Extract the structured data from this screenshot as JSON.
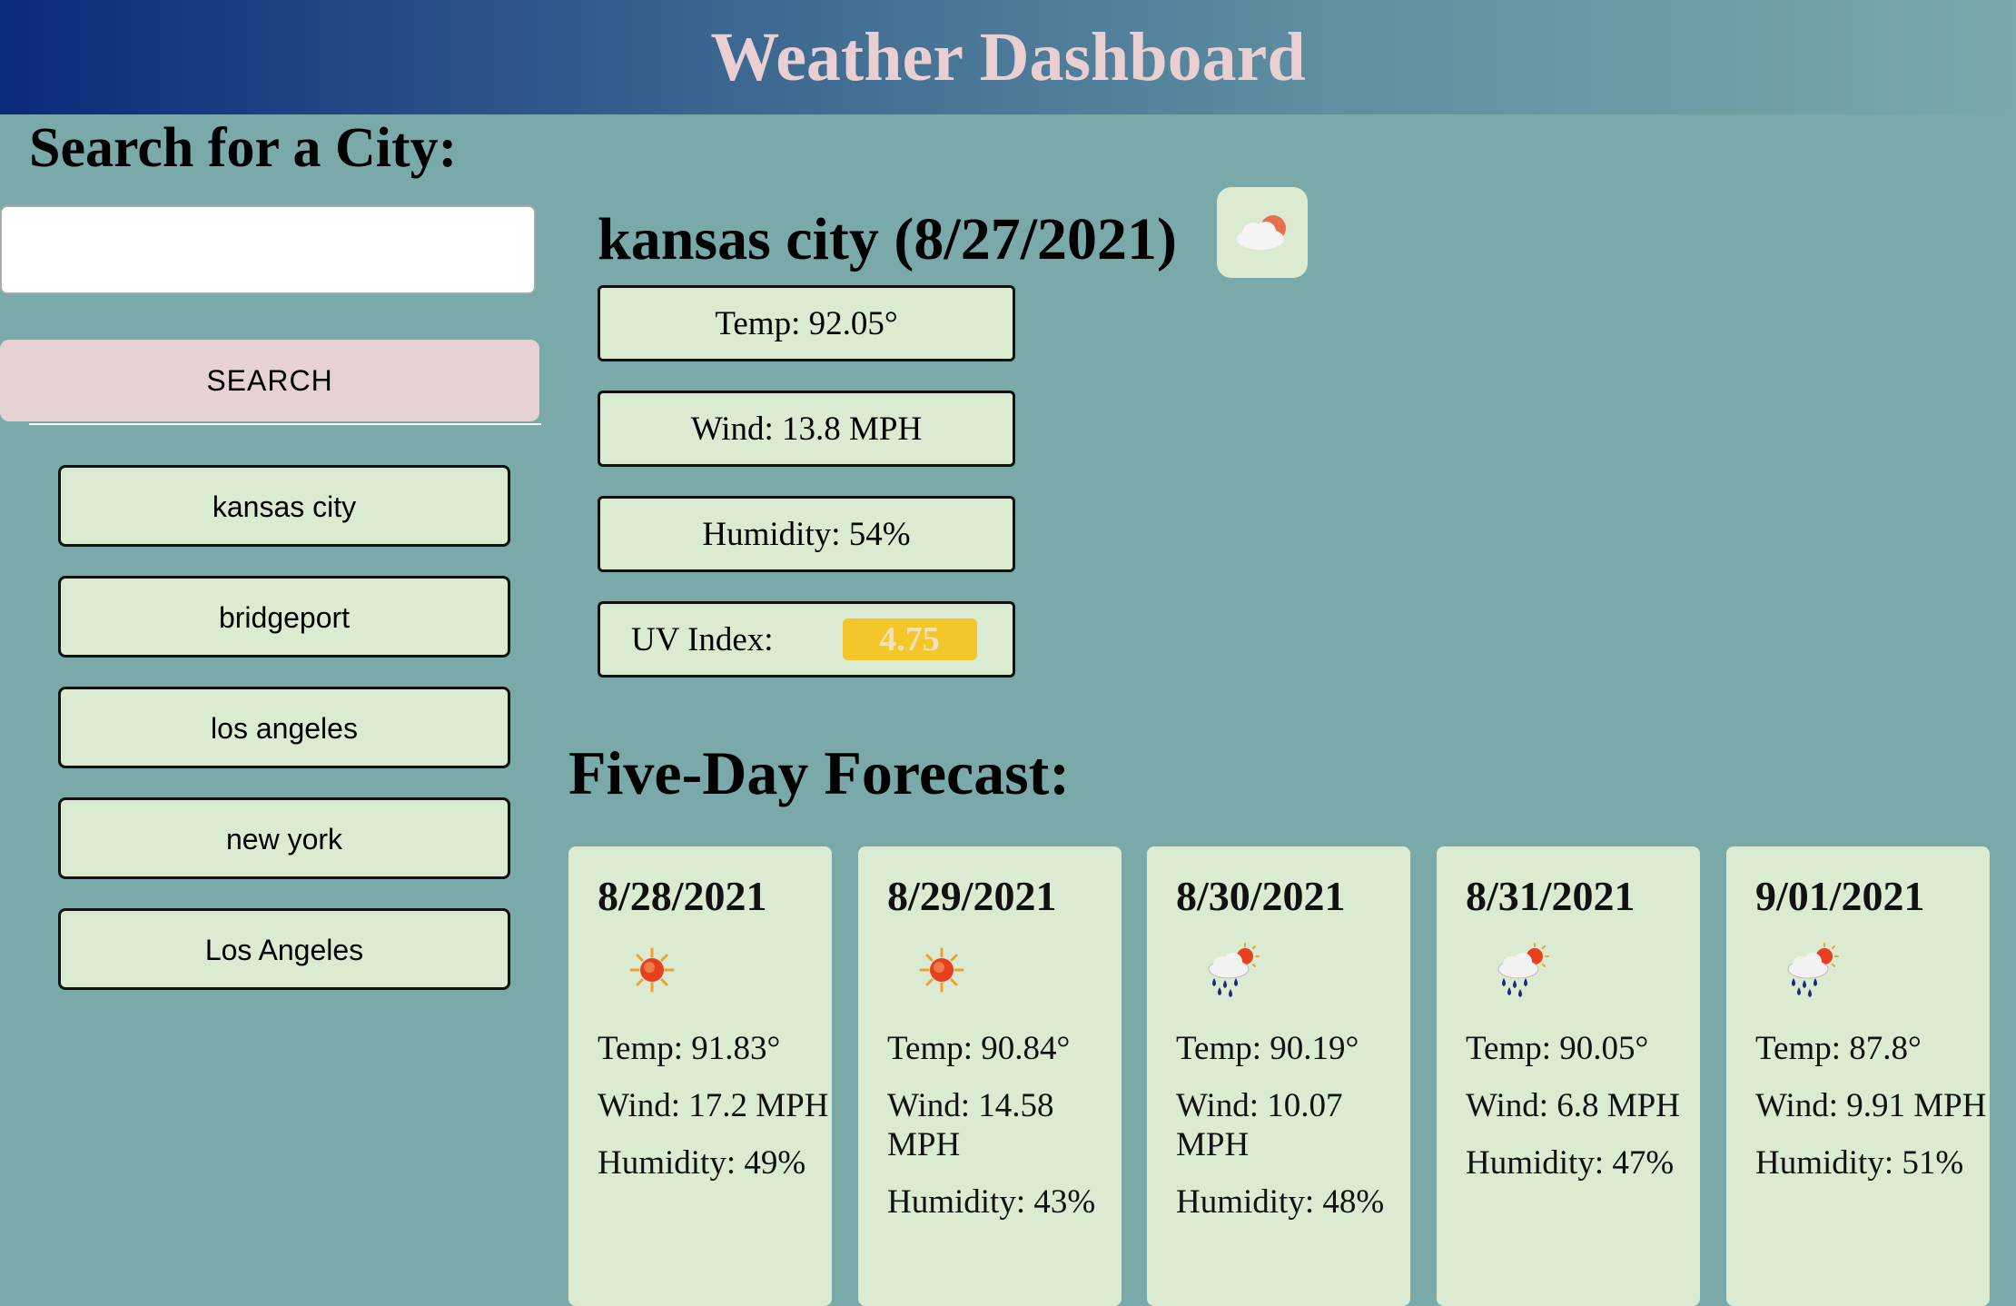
{
  "header": {
    "title": "Weather Dashboard"
  },
  "search": {
    "title": "Search for a City:",
    "input_value": "",
    "button_label": "SEARCH"
  },
  "history": [
    "kansas city",
    "bridgeport",
    "los angeles",
    "new york",
    "Los Angeles"
  ],
  "current": {
    "title": "kansas city (8/27/2021)",
    "icon": "partly-cloudy-icon",
    "temp": "Temp: 92.05°",
    "wind": "Wind: 13.8 MPH",
    "humidity": "Humidity: 54%",
    "uv_label": "UV Index:",
    "uv_value": "4.75",
    "uv_color": "#f3c62a"
  },
  "forecast": {
    "title": "Five-Day Forecast:",
    "days": [
      {
        "date": "8/28/2021",
        "icon": "sun-icon",
        "temp": "Temp: 91.83°",
        "wind": "Wind: 17.2 MPH",
        "humidity": "Humidity: 49%"
      },
      {
        "date": "8/29/2021",
        "icon": "sun-icon",
        "temp": "Temp: 90.84°",
        "wind": "Wind: 14.58 MPH",
        "humidity": "Humidity: 43%"
      },
      {
        "date": "8/30/2021",
        "icon": "rain-sun-icon",
        "temp": "Temp: 90.19°",
        "wind": "Wind: 10.07 MPH",
        "humidity": "Humidity: 48%"
      },
      {
        "date": "8/31/2021",
        "icon": "rain-sun-icon",
        "temp": "Temp: 90.05°",
        "wind": "Wind: 6.8 MPH",
        "humidity": "Humidity: 47%"
      },
      {
        "date": "9/01/2021",
        "icon": "rain-sun-icon",
        "temp": "Temp: 87.8°",
        "wind": "Wind: 9.91 MPH",
        "humidity": "Humidity: 51%"
      }
    ]
  }
}
